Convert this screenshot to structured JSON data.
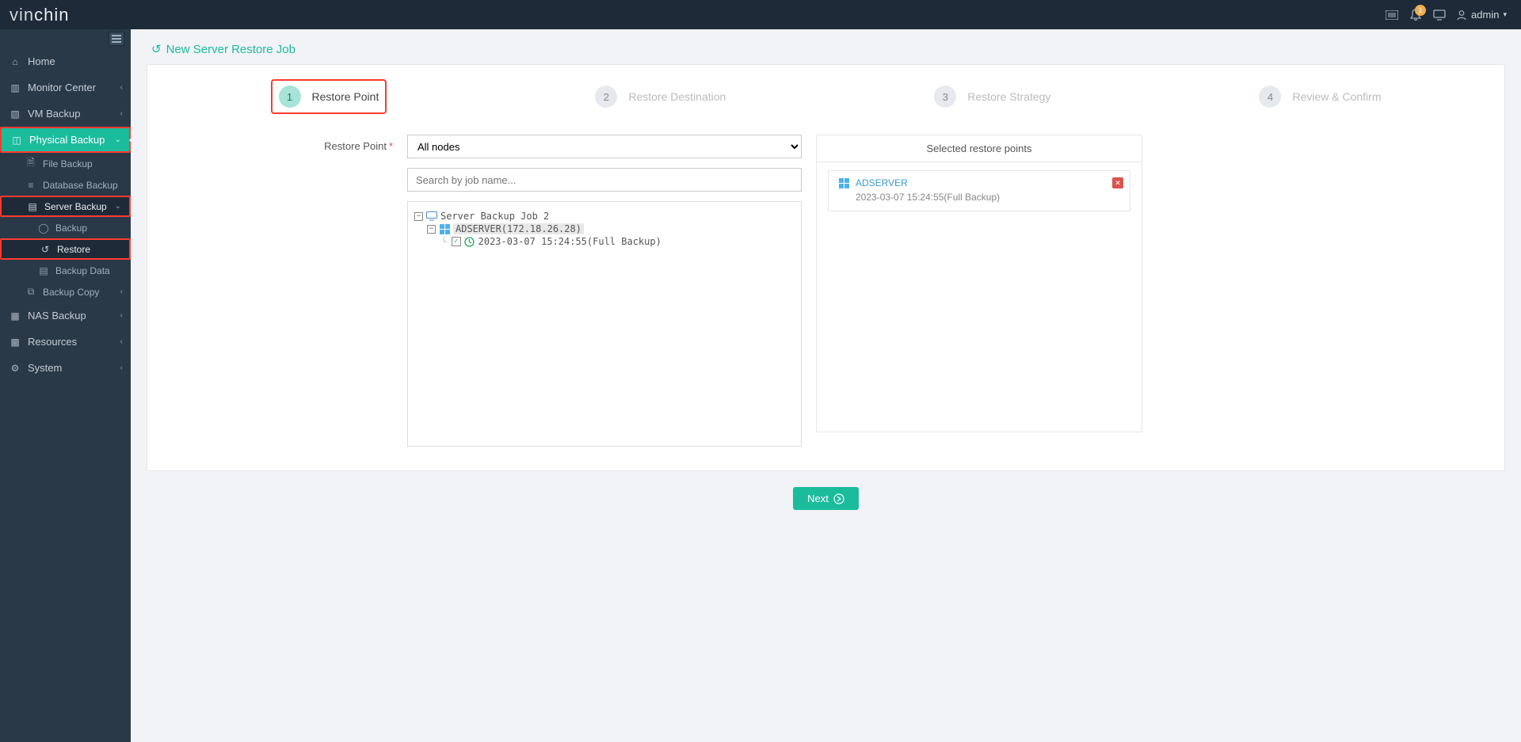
{
  "brand": {
    "part1": "vin",
    "part2": "chin"
  },
  "header": {
    "notification_count": "1",
    "user_label": "admin"
  },
  "sidebar": {
    "home": "Home",
    "monitor": "Monitor Center",
    "vm": "VM Backup",
    "physical": "Physical Backup",
    "file_backup": "File Backup",
    "db_backup": "Database Backup",
    "server_backup": "Server Backup",
    "sb_backup": "Backup",
    "sb_restore": "Restore",
    "sb_data": "Backup Data",
    "backup_copy": "Backup Copy",
    "nas": "NAS Backup",
    "resources": "Resources",
    "system": "System"
  },
  "page": {
    "title": "New Server Restore Job"
  },
  "steps": [
    {
      "num": "1",
      "label": "Restore Point"
    },
    {
      "num": "2",
      "label": "Restore Destination"
    },
    {
      "num": "3",
      "label": "Restore Strategy"
    },
    {
      "num": "4",
      "label": "Review & Confirm"
    }
  ],
  "form": {
    "label_restore_point": "Restore Point",
    "node_select_value": "All nodes",
    "search_placeholder": "Search by job name...",
    "tree": {
      "job": "Server Backup Job 2",
      "host": "ADSERVER(172.18.26.28)",
      "point": "2023-03-07 15:24:55(Full  Backup)"
    }
  },
  "selected": {
    "header": "Selected restore points",
    "item_name": "ADSERVER",
    "item_detail": "2023-03-07 15:24:55(Full Backup)"
  },
  "buttons": {
    "next": "Next"
  }
}
